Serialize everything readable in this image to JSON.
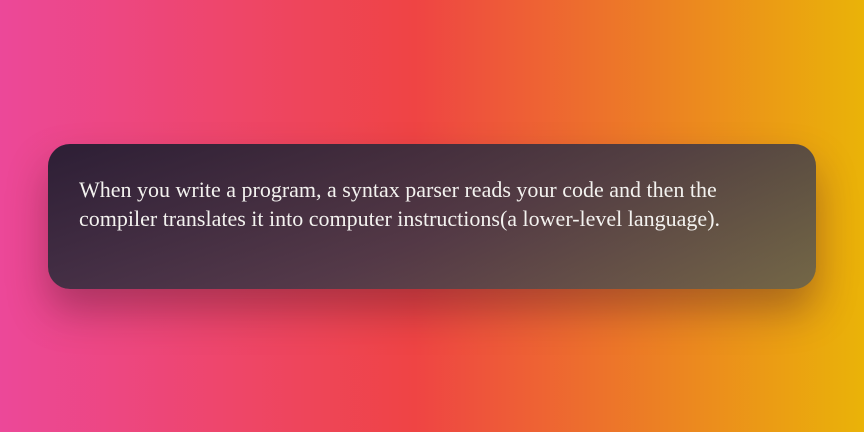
{
  "card": {
    "text": "When you write a program, a syntax parser reads your code and then the compiler translates it into computer instructions(a lower-level language)."
  },
  "colors": {
    "background_left": "#ec4899",
    "background_middle": "#ef4444",
    "background_right": "#eab308",
    "card_dark": "#1e1b2e",
    "card_light": "#5f5c50",
    "text": "#f3f2ef"
  }
}
